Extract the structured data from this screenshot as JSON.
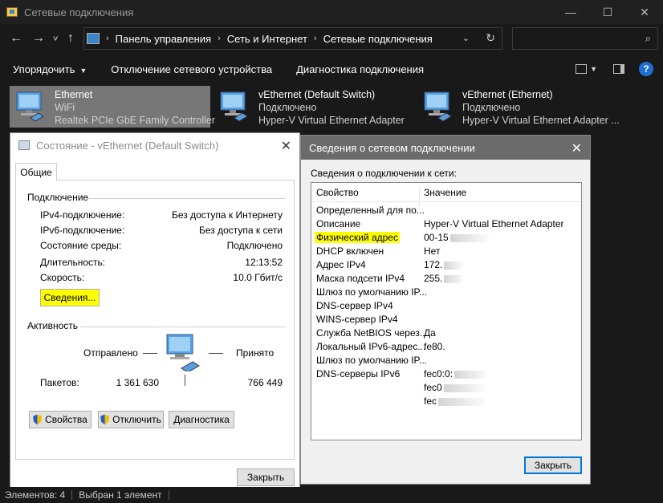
{
  "window": {
    "title": "Сетевые подключения",
    "controls": {
      "minimize": "—",
      "maximize": "☐",
      "close": "✕"
    }
  },
  "nav": {
    "back": "←",
    "forward": "→",
    "recent": "˅",
    "up": "↑",
    "breadcrumbs": [
      "Панель управления",
      "Сеть и Интернет",
      "Сетевые подключения"
    ],
    "search_placeholder": ""
  },
  "toolbar": {
    "organize": "Упорядочить",
    "disconnect": "Отключение сетевого устройства",
    "diagnose": "Диагностика подключения"
  },
  "adapters": [
    {
      "name": "Ethernet",
      "status": "WiFi",
      "device": "Realtek PCIe GbE Family Controller"
    },
    {
      "name": "vEthernet (Default Switch)",
      "status": "Подключено",
      "device": "Hyper-V Virtual Ethernet Adapter"
    },
    {
      "name": "vEthernet (Ethernet)",
      "status": "Подключено",
      "device": "Hyper-V Virtual Ethernet Adapter ..."
    }
  ],
  "status_dialog": {
    "title": "Состояние - vEthernet (Default Switch)",
    "tab": "Общие",
    "connection_section": "Подключение",
    "rows": [
      {
        "label": "IPv4-подключение:",
        "value": "Без доступа к Интернету"
      },
      {
        "label": "IPv6-подключение:",
        "value": "Без доступа к сети"
      },
      {
        "label": "Состояние среды:",
        "value": "Подключено"
      },
      {
        "label": "Длительность:",
        "value": "12:13:52"
      },
      {
        "label": "Скорость:",
        "value": "10.0 Гбит/с"
      }
    ],
    "details_button": "Сведения...",
    "activity_section": "Активность",
    "sent_label": "Отправлено",
    "received_label": "Принято",
    "packets_label": "Пакетов:",
    "packets_sent": "1 361 630",
    "packets_received": "766 449",
    "properties_button": "Свойства",
    "disable_button": "Отключить",
    "diagnose_button": "Диагностика",
    "close_button": "Закрыть"
  },
  "details_dialog": {
    "title": "Сведения о сетевом подключении",
    "subtitle": "Сведения о подключении к сети:",
    "col_property": "Свойство",
    "col_value": "Значение",
    "rows": [
      {
        "property": "Определенный для по...",
        "value": ""
      },
      {
        "property": "Описание",
        "value": "Hyper-V Virtual Ethernet Adapter"
      },
      {
        "property": "Физический адрес",
        "value": "00-15"
      },
      {
        "property": "DHCP включен",
        "value": "Нет"
      },
      {
        "property": "Адрес IPv4",
        "value": "172."
      },
      {
        "property": "Маска подсети IPv4",
        "value": "255."
      },
      {
        "property": "Шлюз по умолчанию IP...",
        "value": ""
      },
      {
        "property": "DNS-сервер IPv4",
        "value": ""
      },
      {
        "property": "WINS-сервер IPv4",
        "value": ""
      },
      {
        "property": "Служба NetBIOS через...",
        "value": "Да"
      },
      {
        "property": "Локальный IPv6-адрес...",
        "value": "fe80."
      },
      {
        "property": "Шлюз по умолчанию IP...",
        "value": ""
      },
      {
        "property": "DNS-серверы IPv6",
        "value": "fec0:0:"
      },
      {
        "property": "",
        "value": "fec0"
      },
      {
        "property": "",
        "value": "fec"
      }
    ],
    "close_button": "Закрыть"
  },
  "statusbar": {
    "items_count": "Элементов: 4",
    "selected": "Выбран 1 элемент"
  },
  "colors": {
    "accent": "#1e6fd1",
    "highlight": "#ffff00",
    "dark_bg": "#191919"
  }
}
